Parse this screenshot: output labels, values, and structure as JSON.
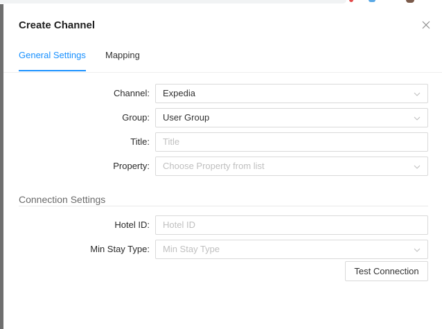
{
  "modal": {
    "title": "Create Channel"
  },
  "tabs": [
    {
      "label": "General Settings",
      "active": true
    },
    {
      "label": "Mapping",
      "active": false
    }
  ],
  "general": {
    "channel": {
      "label": "Channel",
      "value": "Expedia"
    },
    "group": {
      "label": "Group",
      "value": "User Group"
    },
    "title": {
      "label": "Title",
      "value": "",
      "placeholder": "Title"
    },
    "property": {
      "label": "Property",
      "value": "",
      "placeholder": "Choose Property from list"
    }
  },
  "connection": {
    "heading": "Connection Settings",
    "hotel_id": {
      "label": "Hotel ID",
      "value": "",
      "placeholder": "Hotel ID"
    },
    "min_stay_type": {
      "label": "Min Stay Type",
      "value": "",
      "placeholder": "Min Stay Type"
    },
    "test_button": "Test Connection"
  },
  "colors": {
    "accent": "#1890ff",
    "border": "#d9d9d9",
    "placeholder": "#bfbfbf"
  },
  "icons": {
    "close": "close-icon",
    "dropdown": "chevron-down-icon"
  }
}
